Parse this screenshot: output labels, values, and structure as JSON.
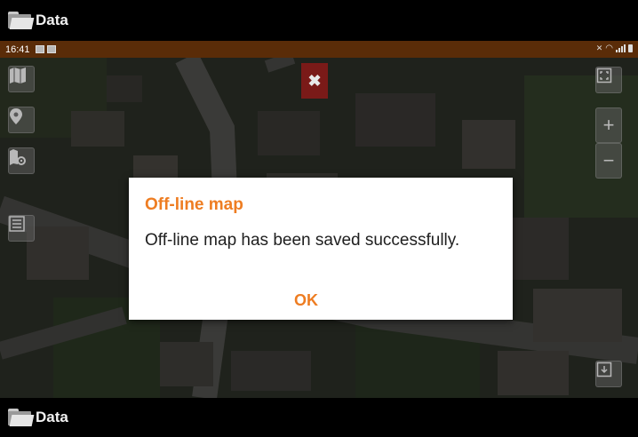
{
  "header": {
    "title": "Data",
    "icon": "folder-icon"
  },
  "status_bar": {
    "time": "16:41"
  },
  "map": {
    "toolbar_left": [
      "map-icon",
      "location-pin-icon",
      "map-settings-icon",
      "layers-list-icon"
    ],
    "toolbar_right": [
      "fullscreen-icon",
      "zoom-in-icon",
      "zoom-out-icon",
      "export-icon"
    ],
    "zoom_in_label": "+",
    "zoom_out_label": "−",
    "close_label": "✖"
  },
  "dialog": {
    "title": "Off-line map",
    "message": "Off-line map has been saved successfully.",
    "ok_label": "OK",
    "accent_color": "#ee7d22"
  },
  "footer": {
    "title": "Data",
    "icon": "folder-icon"
  }
}
